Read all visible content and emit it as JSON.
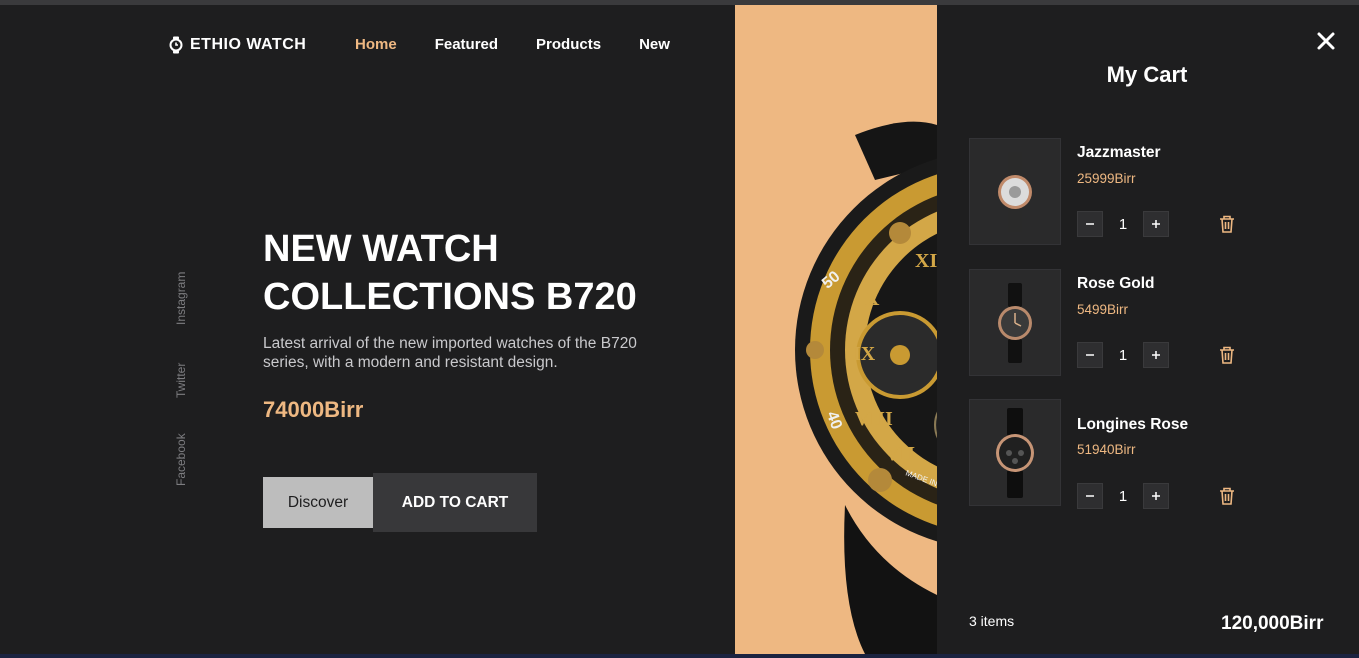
{
  "brand": {
    "name": "ETHIO WATCH",
    "icon": "watch-icon",
    "accent": "#eeb882"
  },
  "nav": {
    "items": [
      {
        "label": "Home",
        "active": true
      },
      {
        "label": "Featured",
        "active": false
      },
      {
        "label": "Products",
        "active": false
      },
      {
        "label": "New",
        "active": false
      }
    ]
  },
  "social": {
    "instagram": "Instagram",
    "twitter": "Twitter",
    "facebook": "Facebook"
  },
  "hero": {
    "title_line1": "NEW WATCH",
    "title_line2": "COLLECTIONS B720",
    "description": "Latest arrival of the new imported watches of the B720 series, with a modern and resistant design.",
    "price": "74000Birr",
    "discover_label": "Discover",
    "add_to_cart_label": "ADD TO CART"
  },
  "cart": {
    "title": "My Cart",
    "close_icon": "close-icon",
    "items": [
      {
        "name": "Jazzmaster",
        "price": "25999Birr",
        "quantity": "1"
      },
      {
        "name": "Rose Gold",
        "price": "5499Birr",
        "quantity": "1"
      },
      {
        "name": "Longines Rose",
        "price": "51940Birr",
        "quantity": "1"
      }
    ],
    "count_text": "3 items",
    "total": "120,000Birr"
  }
}
